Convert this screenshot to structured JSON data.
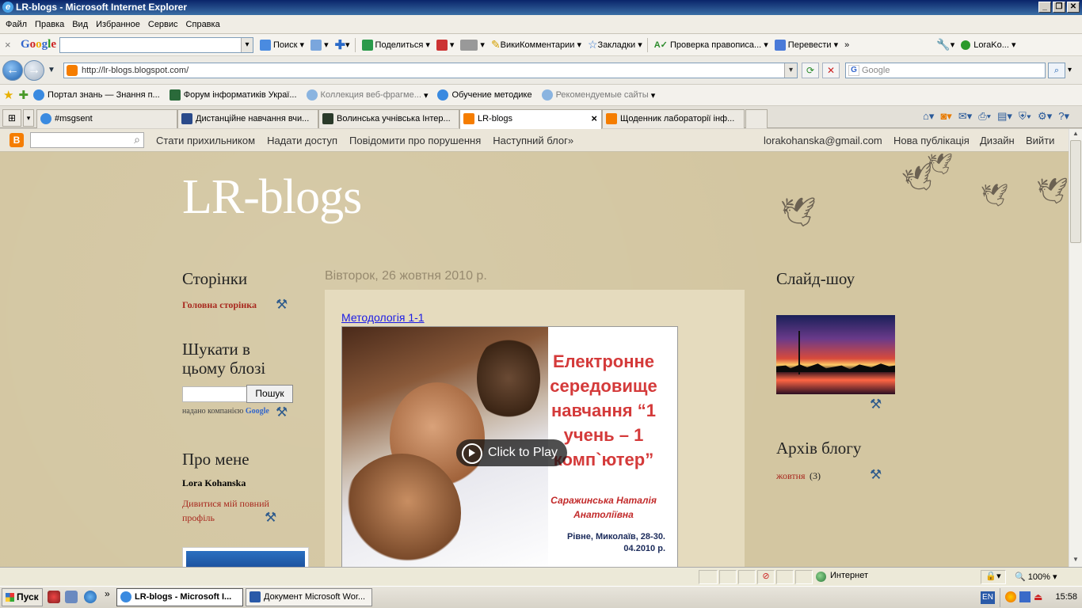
{
  "window": {
    "title": "LR-blogs - Microsoft Internet Explorer"
  },
  "menu": [
    "Файл",
    "Правка",
    "Вид",
    "Избранное",
    "Сервис",
    "Справка"
  ],
  "google_toolbar": {
    "search_btn": "Поиск",
    "share": "Поделиться",
    "wiki": "ВикиКомментарии",
    "bookmarks": "Закладки",
    "spell": "Проверка правописа...",
    "translate": "Перевести",
    "user": "LoraKo..."
  },
  "address": {
    "url": "http://lr-blogs.blogspot.com/",
    "search_placeholder": "Google"
  },
  "favorites": [
    {
      "label": "Портал знань — Знання п..."
    },
    {
      "label": "Форум інформатиків Украї..."
    },
    {
      "label": "Коллекция веб-фрагме..."
    },
    {
      "label": "Обучение методике"
    },
    {
      "label": "Рекомендуемые сайты"
    }
  ],
  "tabs": [
    {
      "label": "#msgsent"
    },
    {
      "label": "Дистанційне навчання вчи..."
    },
    {
      "label": "Волинська учнівська Інтер..."
    },
    {
      "label": "LR-blogs"
    },
    {
      "label": "Щоденник лабораторії інф..."
    }
  ],
  "bloggerbar": {
    "follow": "Стати прихильником",
    "share": "Надати доступ",
    "report": "Повідомити про порушення",
    "next": "Наступний блог»",
    "email": "lorakohanska@gmail.com",
    "newpost": "Нова публікація",
    "design": "Дизайн",
    "logout": "Вийти"
  },
  "blog": {
    "title": "LR-blogs",
    "pages_title": "Сторінки",
    "home_link": "Головна сторінка",
    "search_title": "Шукати в цьому блозі",
    "search_btn": "Пошук",
    "powered_by": "надано компанією",
    "powered_logo": "Google",
    "about_title": "Про мене",
    "author": "Lora Kohanska",
    "profile_link": "Дивитися мій повний профіль",
    "date": "Вівторок, 26 жовтня 2010 р.",
    "post_title": "Методологія 1-1",
    "slide_title": "Електронне середовище навчання “1 учень – 1 комп`ютер”",
    "slide_author": "Саражинська Наталія Анатоліївна",
    "slide_place": "Рівне, Миколаїв, 28-30. 04.2010 р.",
    "play_label": "Click to Play",
    "slideshow_title": "Слайд-шоу",
    "archive_title": "Архів блогу",
    "archive_month": "жовтня",
    "archive_count": "(3)"
  },
  "status": {
    "zone": "Интернет",
    "zoom": "100%"
  },
  "taskbar": {
    "start": "Пуск",
    "items": [
      {
        "label": "LR-blogs - Microsoft I..."
      },
      {
        "label": "Документ Microsoft Wor..."
      }
    ],
    "lang": "EN",
    "time": "15:58"
  }
}
